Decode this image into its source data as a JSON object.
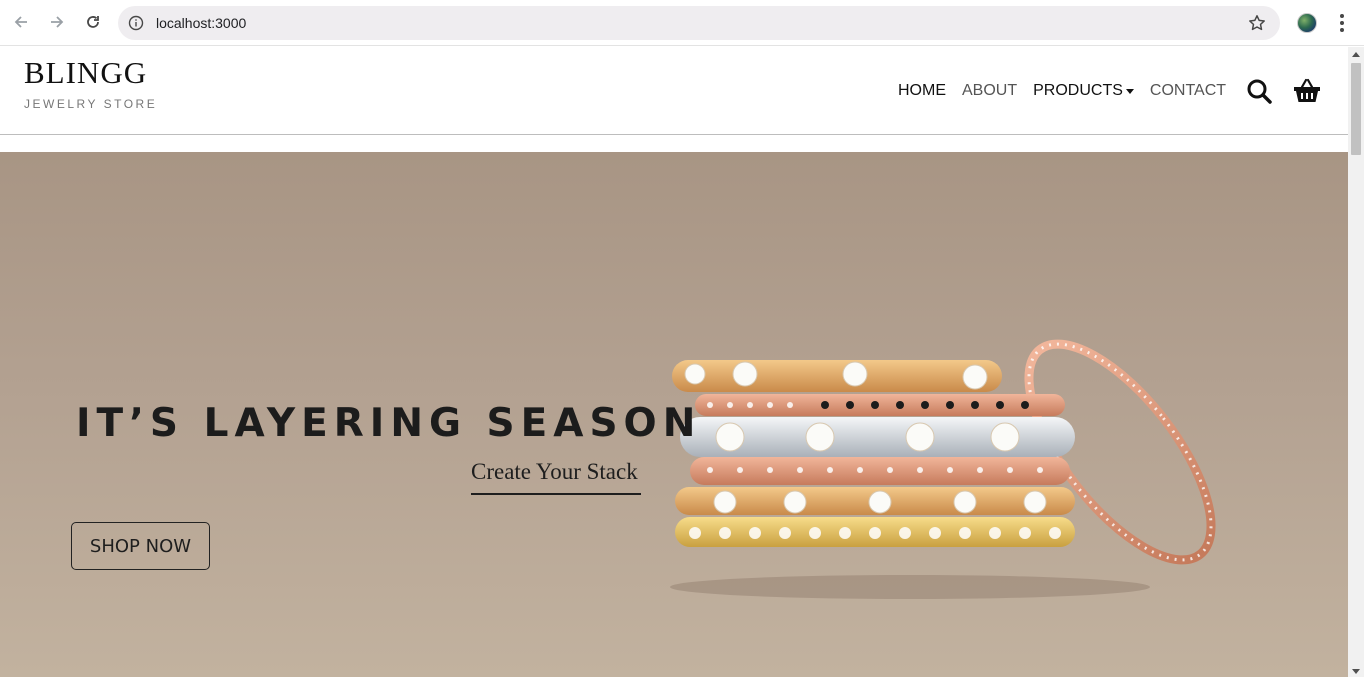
{
  "browser": {
    "url": "localhost:3000"
  },
  "site": {
    "brand_name": "BLINGG",
    "brand_tagline": "JEWELRY STORE",
    "nav": [
      {
        "label": "HOME"
      },
      {
        "label": "ABOUT"
      },
      {
        "label": "PRODUCTS"
      },
      {
        "label": "CONTACT"
      }
    ]
  },
  "hero": {
    "title": "IT’S LAYERING SEASON",
    "subtitle": "Create Your Stack",
    "button_label": "SHOP NOW"
  },
  "colors": {
    "hero_bg": "#b3a191",
    "text_dark": "#1c1c1c",
    "nav_muted": "#555555"
  },
  "icons": [
    "back-icon",
    "forward-icon",
    "reload-icon",
    "info-icon",
    "star-icon",
    "profile-avatar",
    "menu-kebab-icon",
    "search-icon",
    "basket-icon"
  ]
}
